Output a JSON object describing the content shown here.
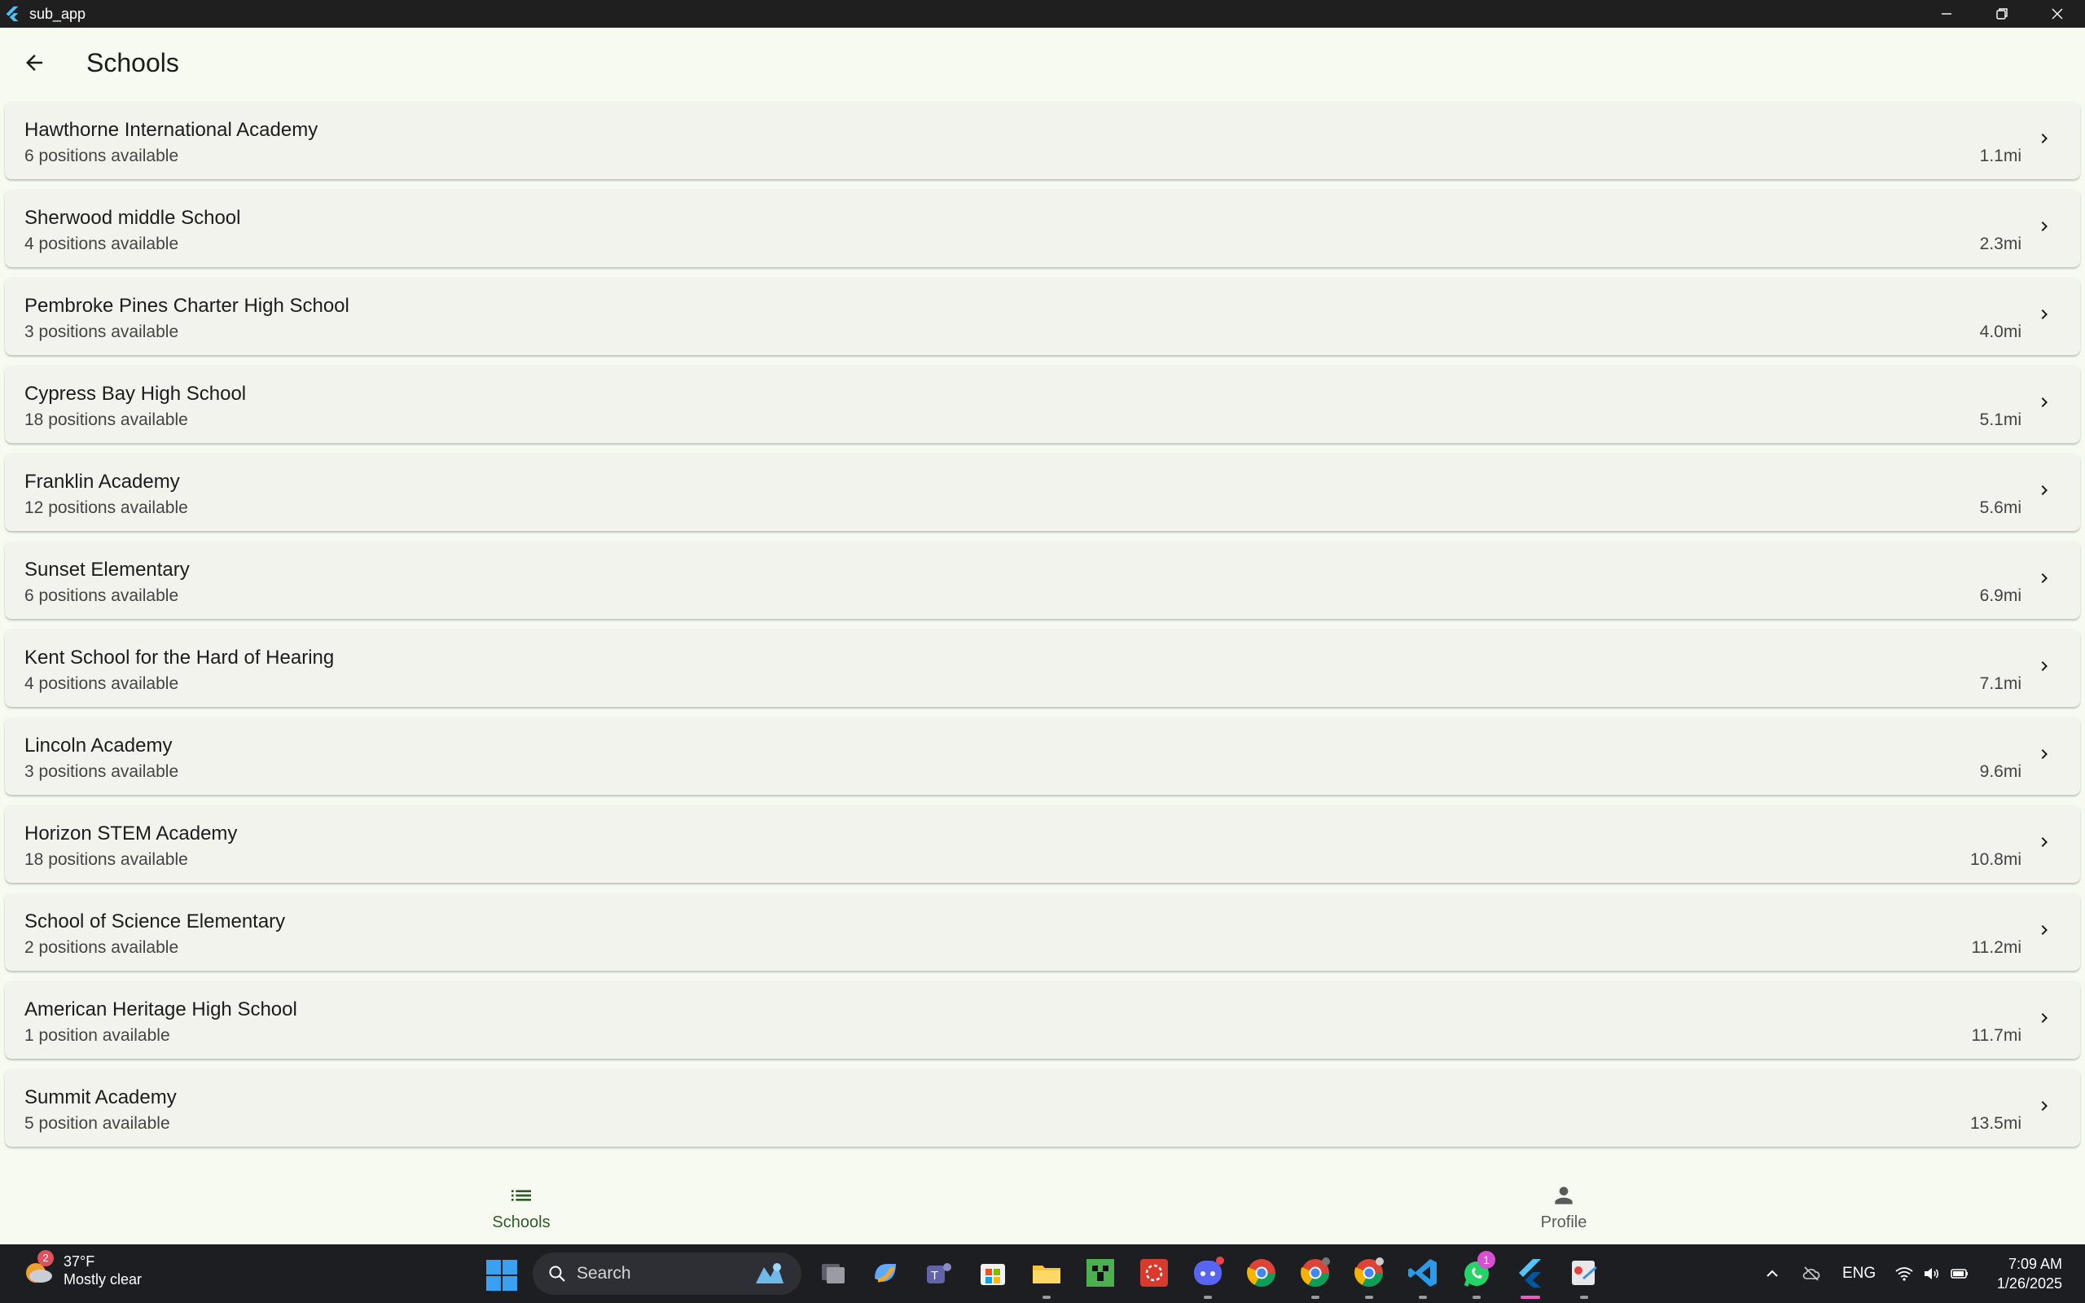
{
  "window": {
    "title": "sub_app"
  },
  "appbar": {
    "title": "Schools"
  },
  "schools": [
    {
      "name": "Hawthorne International Academy",
      "positions": "6 positions available",
      "distance": "1.1mi"
    },
    {
      "name": "Sherwood middle School",
      "positions": "4 positions available",
      "distance": "2.3mi"
    },
    {
      "name": "Pembroke Pines Charter High School",
      "positions": "3 positions available",
      "distance": "4.0mi"
    },
    {
      "name": "Cypress Bay High School",
      "positions": "18 positions available",
      "distance": "5.1mi"
    },
    {
      "name": "Franklin Academy",
      "positions": "12 positions available",
      "distance": "5.6mi"
    },
    {
      "name": "Sunset Elementary",
      "positions": "6 positions available",
      "distance": "6.9mi"
    },
    {
      "name": "Kent School for the Hard of Hearing",
      "positions": "4 positions available",
      "distance": "7.1mi"
    },
    {
      "name": "Lincoln Academy",
      "positions": "3 positions available",
      "distance": "9.6mi"
    },
    {
      "name": "Horizon STEM Academy",
      "positions": "18 positions available",
      "distance": "10.8mi"
    },
    {
      "name": "School of Science Elementary",
      "positions": "2 positions available",
      "distance": "11.2mi"
    },
    {
      "name": "American Heritage High School",
      "positions": "1 position available",
      "distance": "11.7mi"
    },
    {
      "name": "Summit Academy",
      "positions": "5 position available",
      "distance": "13.5mi"
    }
  ],
  "bottom_nav": {
    "schools_label": "Schools",
    "profile_label": "Profile"
  },
  "taskbar": {
    "weather_temp": "37°F",
    "weather_desc": "Mostly clear",
    "weather_badge": "2",
    "search_label": "Search",
    "whatsapp_badge": "1",
    "language": "ENG",
    "time": "7:09 AM",
    "date": "1/26/2025"
  },
  "colors": {
    "background": "#f7faf1",
    "card": "#f1f3ec",
    "nav_active": "#2f5c26",
    "titlebar": "#1f1f1f",
    "taskbar": "#1d1e22"
  }
}
